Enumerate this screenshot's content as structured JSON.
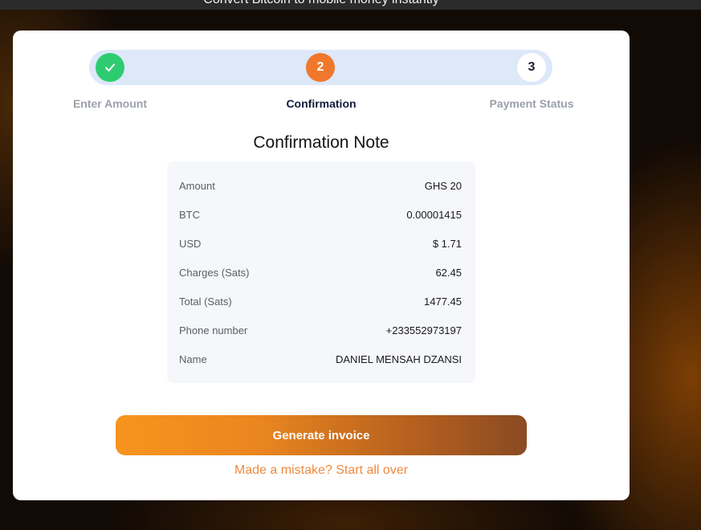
{
  "header": {
    "tagline": "Convert Bitcoin to mobile money instantly"
  },
  "stepper": {
    "steps": [
      {
        "label": "Enter Amount",
        "state": "completed",
        "icon": "check-icon",
        "color": "#2ECC71"
      },
      {
        "label": "Confirmation",
        "number": "2",
        "state": "active",
        "color": "#F0782C"
      },
      {
        "label": "Payment Status",
        "number": "3",
        "state": "pending",
        "color": "#FFFFFF"
      }
    ]
  },
  "confirmation": {
    "title": "Confirmation Note",
    "rows": [
      {
        "label": "Amount",
        "value": "GHS 20"
      },
      {
        "label": "BTC",
        "value": "0.00001415"
      },
      {
        "label": "USD",
        "value": "$ 1.71"
      },
      {
        "label": "Charges (Sats)",
        "value": "62.45"
      },
      {
        "label": "Total (Sats)",
        "value": "1477.45"
      },
      {
        "label": "Phone number",
        "value": "+233552973197"
      },
      {
        "label": "Name",
        "value": "DANIEL MENSAH DZANSI"
      }
    ]
  },
  "actions": {
    "generate_label": "Generate invoice",
    "restart_label": "Made a mistake? Start all over"
  },
  "colors": {
    "accent": "#F0782C",
    "success": "#2ECC71",
    "button_gradient_start": "#F7941E",
    "button_gradient_end": "#8A4A22"
  }
}
